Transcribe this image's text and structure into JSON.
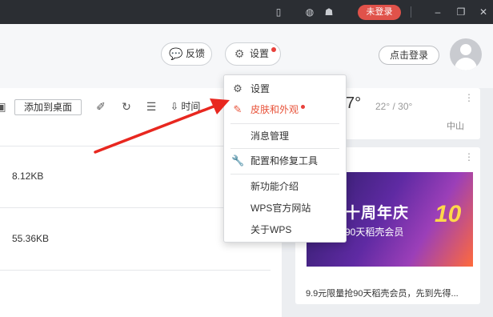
{
  "titlebar": {
    "login_label": "未登录"
  },
  "header": {
    "feedback_label": "反馈",
    "settings_label": "设置",
    "login_button": "点击登录"
  },
  "files": {
    "add_desktop_label": "添加到桌面",
    "sort_label": "时间",
    "rows": [
      {
        "size": "8.12KB"
      },
      {
        "size": "55.36KB"
      }
    ]
  },
  "weather": {
    "temp": "7°",
    "range": "22° / 30°",
    "city": "中山"
  },
  "promo": {
    "banner_title": "十周年庆",
    "banner_sub": "90天稻壳会员",
    "banner_number": "10",
    "caption": "9.9元限量抢90天稻壳会员，先到先得..."
  },
  "menu": {
    "items": [
      {
        "label": "设置",
        "icon": "gear-icon"
      },
      {
        "label": "皮肤和外观",
        "icon": "brush-icon"
      },
      {
        "label": "消息管理",
        "icon": ""
      },
      {
        "label": "配置和修复工具",
        "icon": "wrench-icon"
      },
      {
        "label": "新功能介绍",
        "icon": ""
      },
      {
        "label": "WPS官方网站",
        "icon": ""
      },
      {
        "label": "关于WPS",
        "icon": ""
      }
    ]
  },
  "colors": {
    "accent_red": "#e8403b",
    "highlight_orange": "#e8533a",
    "titlebar_bg": "#2b2e33"
  }
}
